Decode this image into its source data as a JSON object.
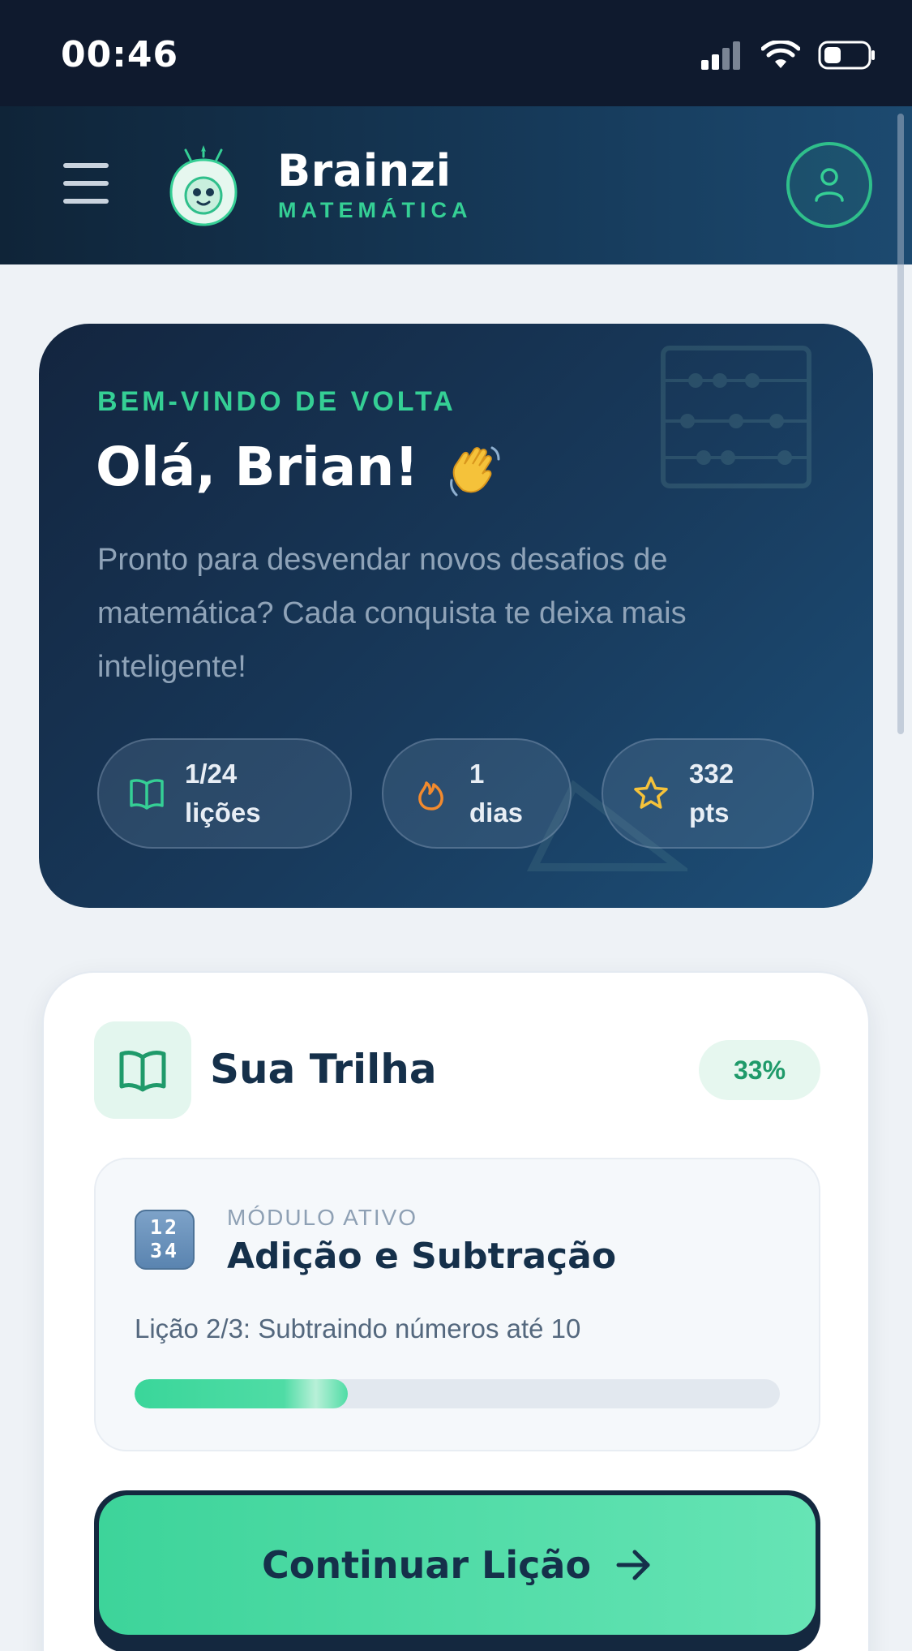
{
  "status_bar": {
    "time": "00:46"
  },
  "header": {
    "brand_name": "Brainzi",
    "brand_sub": "MATEMÁTICA"
  },
  "hero": {
    "eyebrow": "BEM-VINDO DE VOLTA",
    "title": "Olá, Brian!",
    "text": "Pronto para desvendar novos desafios de matemática? Cada conquista te deixa mais inteligente!",
    "stats": [
      {
        "icon": "book-open-icon",
        "line1": "1/24",
        "line2": "lições"
      },
      {
        "icon": "flame-icon",
        "line1": "1",
        "line2": "dias"
      },
      {
        "icon": "star-icon",
        "line1": "332",
        "line2": "pts"
      }
    ]
  },
  "track": {
    "title": "Sua Trilha",
    "percent_label": "33%",
    "module": {
      "badge": [
        "12",
        "34"
      ],
      "eyebrow": "MÓDULO ATIVO",
      "name": "Adição e Subtração",
      "lesson": "Lição 2/3: Subtraindo números até 10",
      "progress": 0.33
    },
    "cta_label": "Continuar Lição"
  },
  "colors": {
    "accent": "#35cf95",
    "dark": "#15304a",
    "hero_bg": "#183a5c"
  }
}
